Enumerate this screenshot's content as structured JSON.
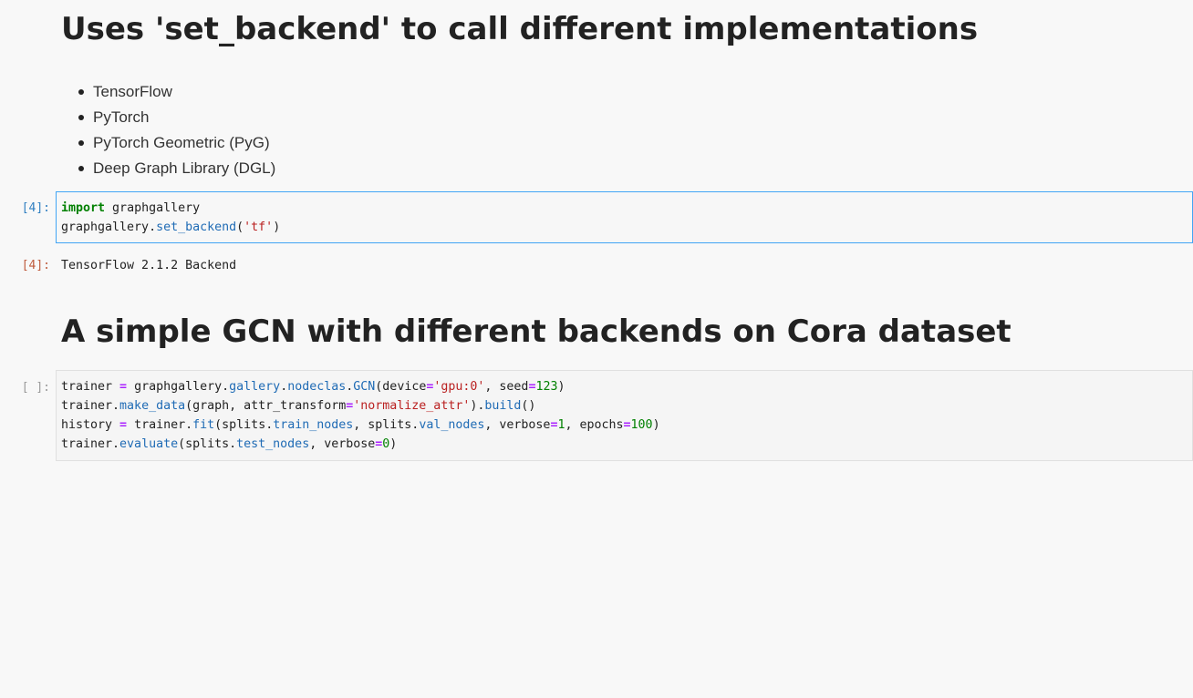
{
  "markdown1": {
    "heading": "Uses 'set_backend' to call different implementations",
    "list": [
      "TensorFlow",
      "PyTorch",
      "PyTorch Geometric (PyG)",
      "Deep Graph Library (DGL)"
    ]
  },
  "cell1": {
    "in_prompt": "[4]:",
    "line1": {
      "kw": "import",
      "rest": " graphgallery"
    },
    "line2": {
      "obj": "graphgallery.",
      "method": "set_backend",
      "open": "(",
      "str": "'tf'",
      "close": ")"
    },
    "out_prompt": "[4]:",
    "output": "TensorFlow 2.1.2 Backend"
  },
  "markdown2": {
    "heading": "A simple GCN with different backends on Cora dataset"
  },
  "cell2": {
    "in_prompt": "[ ]:",
    "l1": {
      "a": "trainer ",
      "eq": "=",
      "b": " graphgallery.",
      "c": "gallery",
      "d": ".",
      "e": "nodeclas",
      "f": ".",
      "g": "GCN",
      "h": "(device",
      "eq2": "=",
      "s": "'gpu:0'",
      "i": ", seed",
      "eq3": "=",
      "n": "123",
      "j": ")"
    },
    "l2": {
      "a": "trainer.",
      "b": "make_data",
      "c": "(graph, attr_transform",
      "eq": "=",
      "s": "'normalize_attr'",
      "d": ").",
      "e": "build",
      "f": "()"
    },
    "l3": {
      "a": "history ",
      "eq": "=",
      "b": " trainer.",
      "c": "fit",
      "d": "(splits.",
      "e": "train_nodes",
      "f": ", splits.",
      "g": "val_nodes",
      "h": ", verbose",
      "eq2": "=",
      "n": "1",
      "i": ", epochs",
      "eq3": "=",
      "n2": "100",
      "j": ")"
    },
    "l4": {
      "a": "trainer.",
      "b": "evaluate",
      "c": "(splits.",
      "d": "test_nodes",
      "e": ", verbose",
      "eq": "=",
      "n": "0",
      "f": ")"
    }
  }
}
